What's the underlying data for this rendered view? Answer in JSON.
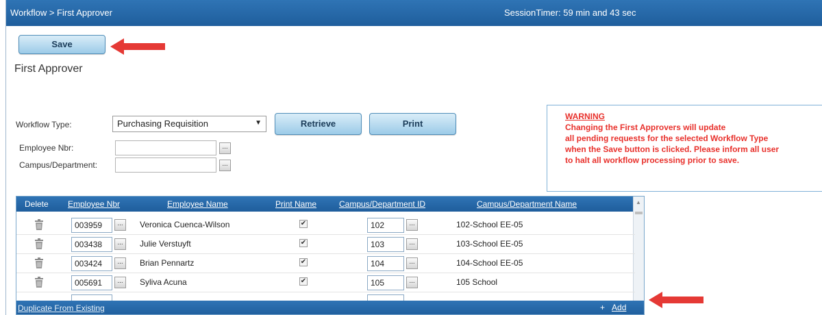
{
  "header": {
    "breadcrumb": "Workflow > First Approver",
    "session_timer": "SessionTimer: 59 min and 43 sec"
  },
  "toolbar": {
    "save_label": "Save"
  },
  "page": {
    "title": "First Approver"
  },
  "form": {
    "workflow_type_label": "Workflow Type:",
    "workflow_type_value": "Purchasing Requisition",
    "employee_nbr_label": "Employee Nbr:",
    "employee_nbr_value": "",
    "campus_dept_label": "Campus/Department:",
    "campus_dept_value": "",
    "retrieve_label": "Retrieve",
    "print_label": "Print",
    "ellipsis": "..."
  },
  "warning": {
    "title": "WARNING",
    "lines": [
      "Changing the First Approvers will update",
      "all pending requests for the selected Workflow Type",
      "when the Save button is clicked. Please inform all user",
      "to halt all workflow processing prior to save."
    ]
  },
  "grid": {
    "columns": {
      "delete": "Delete",
      "employee_nbr": "Employee Nbr",
      "employee_name": "Employee Name",
      "print_name": "Print Name",
      "campus_dept_id": "Campus/Department ID",
      "campus_dept_name": "Campus/Department Name"
    },
    "rows": [
      {
        "employee_nbr": "003959",
        "employee_name": "Veronica Cuenca-Wilson",
        "print_name": true,
        "campus_dept_id": "102",
        "campus_dept_name": "102-School EE-05"
      },
      {
        "employee_nbr": "003438",
        "employee_name": "Julie Verstuyft",
        "print_name": true,
        "campus_dept_id": "103",
        "campus_dept_name": "103-School EE-05"
      },
      {
        "employee_nbr": "003424",
        "employee_name": "Brian Pennartz",
        "print_name": true,
        "campus_dept_id": "104",
        "campus_dept_name": "104-School EE-05"
      },
      {
        "employee_nbr": "005691",
        "employee_name": "Syliva Acuna",
        "print_name": true,
        "campus_dept_id": "105",
        "campus_dept_name": "105 School"
      }
    ],
    "footer": {
      "duplicate_label": "Duplicate From Existing",
      "add_icon": "+",
      "add_label": "Add"
    }
  },
  "colors": {
    "header_blue": "#2f74b5",
    "button_blue": "#9ccbe8",
    "warning_red": "#e8302b",
    "arrow_red": "#e53935"
  }
}
